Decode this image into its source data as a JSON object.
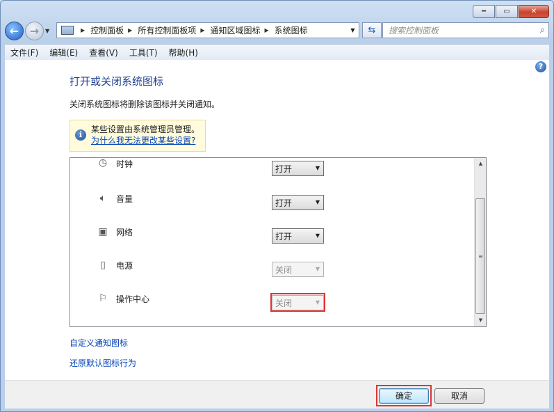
{
  "window": {
    "minimize": "━",
    "maximize": "▭",
    "close": "✕"
  },
  "nav": {
    "back": "←",
    "forward": "→",
    "breadcrumbs": [
      "控制面板",
      "所有控制面板项",
      "通知区域图标",
      "系统图标"
    ],
    "search_placeholder": "搜索控制面板"
  },
  "menu": [
    "文件(F)",
    "编辑(E)",
    "查看(V)",
    "工具(T)",
    "帮助(H)"
  ],
  "content": {
    "title": "打开或关闭系统图标",
    "subtitle": "关闭系统图标将删除该图标并关闭通知。",
    "info": {
      "text": "某些设置由系统管理员管理。",
      "link": "为什么我无法更改某些设置?"
    },
    "rows": [
      {
        "icon": "clock-icon",
        "label": "时钟",
        "value": "打开",
        "enabled": true
      },
      {
        "icon": "volume-icon",
        "label": "音量",
        "value": "打开",
        "enabled": true
      },
      {
        "icon": "network-icon",
        "label": "网络",
        "value": "打开",
        "enabled": true
      },
      {
        "icon": "power-icon",
        "label": "电源",
        "value": "关闭",
        "enabled": false
      },
      {
        "icon": "flag-icon",
        "label": "操作中心",
        "value": "关闭",
        "enabled": false
      }
    ],
    "links": [
      "自定义通知图标",
      "还原默认图标行为"
    ]
  },
  "footer": {
    "ok": "确定",
    "cancel": "取消"
  },
  "colors": {
    "highlight": "#e03434",
    "link": "#0645b8",
    "title": "#1e3f8c"
  }
}
